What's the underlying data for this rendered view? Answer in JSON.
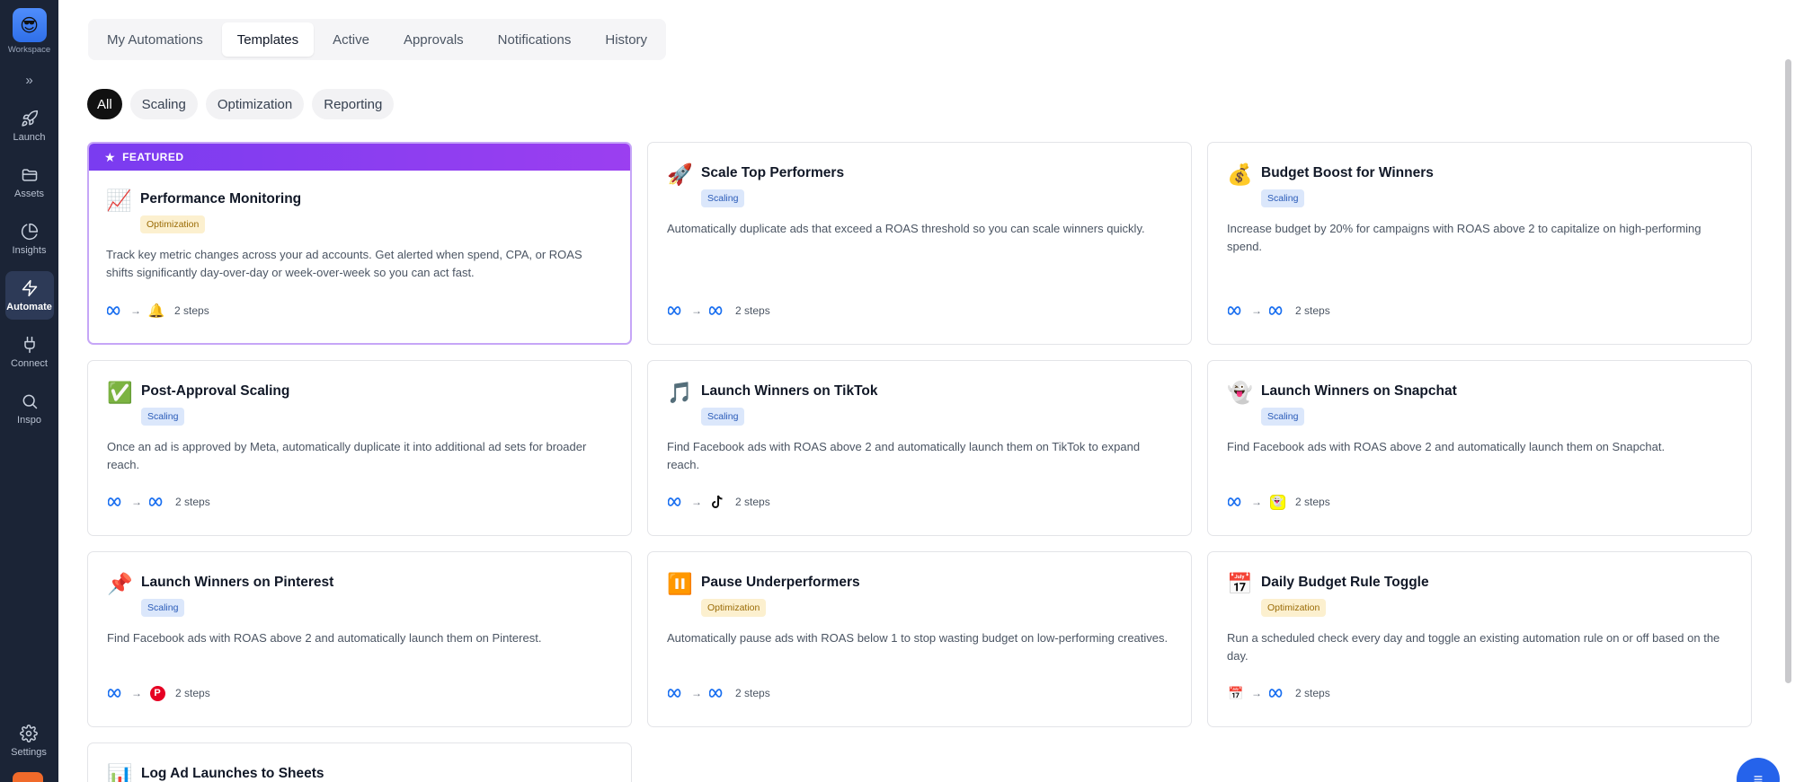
{
  "sidebar": {
    "workspace_label": "Workspace",
    "workspace_emoji": "😎",
    "expand_icon": "»",
    "items": [
      {
        "label": "Launch",
        "icon": "rocket-icon"
      },
      {
        "label": "Assets",
        "icon": "folder-icon"
      },
      {
        "label": "Insights",
        "icon": "pie-chart-icon"
      },
      {
        "label": "Automate",
        "icon": "lightning-icon",
        "active": true
      },
      {
        "label": "Connect",
        "icon": "plug-icon"
      },
      {
        "label": "Inspo",
        "icon": "search-icon"
      }
    ],
    "settings_label": "Settings"
  },
  "tabs": [
    "My Automations",
    "Templates",
    "Active",
    "Approvals",
    "Notifications",
    "History"
  ],
  "active_tab": "Templates",
  "filters": [
    "All",
    "Scaling",
    "Optimization",
    "Reporting"
  ],
  "active_filter": "All",
  "featured_label": "FEATURED",
  "cards": [
    {
      "emoji": "📈",
      "title": "Performance Monitoring",
      "badge": "Optimization",
      "desc": "Track key metric changes across your ad accounts. Get alerted when spend, CPA, or ROAS shifts significantly day-over-day or week-over-week so you can act fast.",
      "from": "meta",
      "to": "bell",
      "steps": "2 steps",
      "featured": true
    },
    {
      "emoji": "🚀",
      "title": "Scale Top Performers",
      "badge": "Scaling",
      "desc": "Automatically duplicate ads that exceed a ROAS threshold so you can scale winners quickly.",
      "from": "meta",
      "to": "meta",
      "steps": "2 steps"
    },
    {
      "emoji": "💰",
      "title": "Budget Boost for Winners",
      "badge": "Scaling",
      "desc": "Increase budget by 20% for campaigns with ROAS above 2 to capitalize on high-performing spend.",
      "from": "meta",
      "to": "meta",
      "steps": "2 steps"
    },
    {
      "emoji": "✅",
      "title": "Post-Approval Scaling",
      "badge": "Scaling",
      "desc": "Once an ad is approved by Meta, automatically duplicate it into additional ad sets for broader reach.",
      "from": "meta",
      "to": "meta",
      "steps": "2 steps"
    },
    {
      "emoji": "🎵",
      "title": "Launch Winners on TikTok",
      "badge": "Scaling",
      "desc": "Find Facebook ads with ROAS above 2 and automatically launch them on TikTok to expand reach.",
      "from": "meta",
      "to": "tiktok",
      "steps": "2 steps"
    },
    {
      "emoji": "👻",
      "title": "Launch Winners on Snapchat",
      "badge": "Scaling",
      "desc": "Find Facebook ads with ROAS above 2 and automatically launch them on Snapchat.",
      "from": "meta",
      "to": "snapchat",
      "steps": "2 steps"
    },
    {
      "emoji": "📌",
      "title": "Launch Winners on Pinterest",
      "badge": "Scaling",
      "desc": "Find Facebook ads with ROAS above 2 and automatically launch them on Pinterest.",
      "from": "meta",
      "to": "pinterest",
      "steps": "2 steps"
    },
    {
      "emoji": "⏸️",
      "title": "Pause Underperformers",
      "badge": "Optimization",
      "desc": "Automatically pause ads with ROAS below 1 to stop wasting budget on low-performing creatives.",
      "from": "meta",
      "to": "meta",
      "steps": "2 steps"
    },
    {
      "emoji": "📅",
      "title": "Daily Budget Rule Toggle",
      "badge": "Optimization",
      "desc": "Run a scheduled check every day and toggle an existing automation rule on or off based on the day.",
      "from": "calendar",
      "to": "meta",
      "steps": "2 steps"
    },
    {
      "emoji": "📊",
      "title": "Log Ad Launches to Sheets"
    }
  ]
}
